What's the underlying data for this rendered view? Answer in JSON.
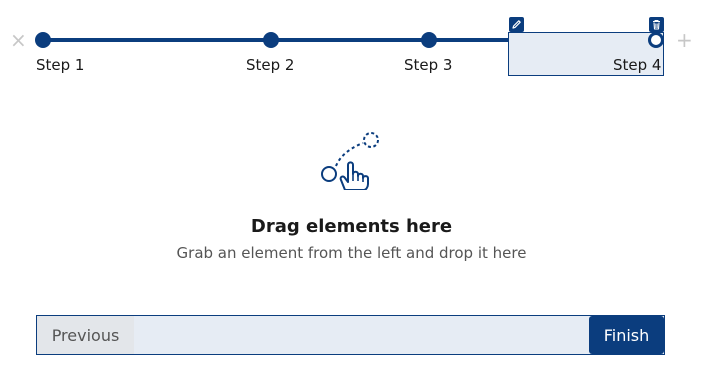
{
  "stepper": {
    "steps": [
      {
        "label": "Step 1"
      },
      {
        "label": "Step 2"
      },
      {
        "label": "Step 3"
      },
      {
        "label": "Step 4"
      }
    ],
    "remove_icon": "×",
    "add_icon": "+"
  },
  "dropzone": {
    "title": "Drag elements here",
    "subtitle": "Grab an element from the left and drop it here",
    "icon": "drag-hand-icon"
  },
  "footer": {
    "previous_label": "Previous",
    "finish_label": "Finish"
  },
  "colors": {
    "accent": "#0b3d7e",
    "selected_bg": "#e6ecf4",
    "muted": "#c7c7c7"
  }
}
